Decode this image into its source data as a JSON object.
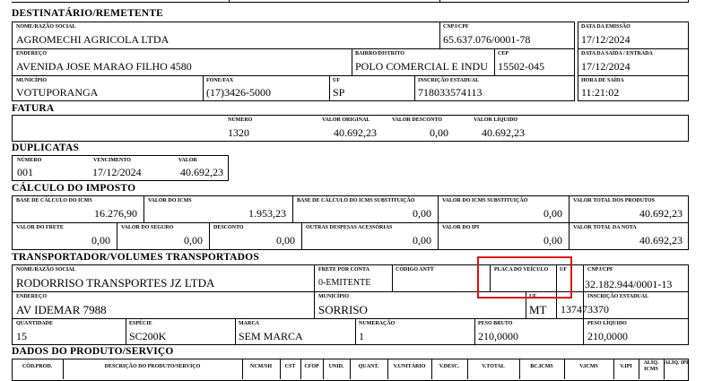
{
  "sections": {
    "destinatario": "DESTINATÁRIO/REMETENTE",
    "fatura": "FATURA",
    "duplicatas": "DUPLICATAS",
    "calculo": "CÁLCULO DO IMPOSTO",
    "transportador": "TRANSPORTADOR/VOLUMES TRANSPORTADOS",
    "produtos": "DADOS DO PRODUTO/SERVIÇO"
  },
  "dest": {
    "nome_label": "NOME/RAZÃO SOCIAL",
    "nome": "AGROMECHI AGRICOLA LTDA",
    "cnpj_label": "CNPJ/CPF",
    "cnpj": "65.637.076/0001-78",
    "emissao_label": "DATA DA EMISSÃO",
    "emissao": "17/12/2024",
    "endereco_label": "ENDEREÇO",
    "endereco": "AVENIDA JOSE MARAO FILHO 4580",
    "bairro_label": "BAIRRO/DISTRITO",
    "bairro": "POLO COMERCIAL E INDU",
    "cep_label": "CEP",
    "cep": "15502-045",
    "saida_label": "DATA DA SAÍDA / ENTRADA",
    "saida": "17/12/2024",
    "municipio_label": "MUNICÍPIO",
    "municipio": "VOTUPORANGA",
    "fone_label": "FONE/FAX",
    "fone": "(17)3426-5000",
    "uf_label": "UF",
    "uf": "SP",
    "ie_label": "INSCRIÇÃO ESTADUAL",
    "ie": "718033574113",
    "hora_label": "HORA DE SAÍDA",
    "hora": "11:21:02"
  },
  "fatura": {
    "numero_label": "NÚMERO",
    "numero": "1320",
    "original_label": "VALOR ORIGINAL",
    "original": "40.692,23",
    "desconto_label": "VALOR DESCONTO",
    "desconto": "0,00",
    "liquido_label": "VALOR LÍQUIDO",
    "liquido": "40.692,23"
  },
  "duplicatas": {
    "numero_label": "NÚMERO",
    "numero": "001",
    "vencimento_label": "VENCIMENTO",
    "vencimento": "17/12/2024",
    "valor_label": "VALOR",
    "valor": "40.692,23"
  },
  "calculo": {
    "row1": [
      {
        "label": "BASE DE CÁLCULO DO ICMS",
        "value": "16.276,90"
      },
      {
        "label": "VALOR DO ICMS",
        "value": "1.953,23"
      },
      {
        "label": "BASE DE CÁLCULO DO ICMS SUBSTITUIÇÃO",
        "value": "0,00"
      },
      {
        "label": "VALOR DO ICMS SUBSTITUIÇÃO",
        "value": "0,00"
      },
      {
        "label": "VALOR TOTAL DOS PRODUTOS",
        "value": "40.692,23"
      }
    ],
    "row2": [
      {
        "label": "VALOR DO FRETE",
        "value": "0,00"
      },
      {
        "label": "VALOR DO SEGURO",
        "value": "0,00"
      },
      {
        "label": "DESCONTO",
        "value": "0,00"
      },
      {
        "label": "OUTRAS DESPESAS ACESSÓRIAS",
        "value": "0,00"
      },
      {
        "label": "VALOR DO IPI",
        "value": "0,00"
      },
      {
        "label": "VALOR TOTAL DA NOTA",
        "value": "40.692,23"
      }
    ]
  },
  "transp": {
    "nome_label": "NOME/RAZÃO SOCIAL",
    "nome": "RODORRISO TRANSPORTES JZ LTDA",
    "frete_label": "FRETE POR CONTA",
    "frete": "0-EMITENTE",
    "antt_label": "CÓDIGO ANTT",
    "placa_label": "PLACA DO VEÍCULO",
    "uf_label": "UF",
    "cnpj_label": "CNPJ/CPF",
    "cnpj": "32.182.944/0001-13",
    "endereco_label": "ENDEREÇO",
    "endereco": "AV IDEMAR 7988",
    "municipio_label": "MUNICÍPIO",
    "municipio": "SORRISO",
    "uf2_label": "UF",
    "uf2": "MT",
    "ie_label": "INSCRIÇÃO ESTADUAL",
    "ie": "137473370",
    "quantidade_label": "QUANTIDADE",
    "quantidade": "15",
    "especie_label": "ESPÉCIE",
    "especie": "SC200K",
    "marca_label": "MARCA",
    "marca": "SEM MARCA",
    "numeracao_label": "NUMERAÇÃO",
    "numeracao": "1",
    "bruto_label": "PESO BRUTO",
    "bruto": "210,0000",
    "liquido_label": "PESO LÍQUIDO",
    "liquido": "210,0000"
  },
  "produtos": {
    "headers": [
      "CÓD.PROD.",
      "DESCRIÇÃO DO PRODUTO/SERVIÇO",
      "NCM/SH",
      "CST",
      "CFOP",
      "UNID.",
      "QUANT.",
      "V.UNITÁRIO",
      "V.DESC.",
      "V.TOTAL",
      "BC.ICMS",
      "V.ICMS",
      "V.IPI",
      "ALÍQ. ICMS",
      "ALÍQ. IPI"
    ]
  },
  "highlight_color": "#e01010"
}
